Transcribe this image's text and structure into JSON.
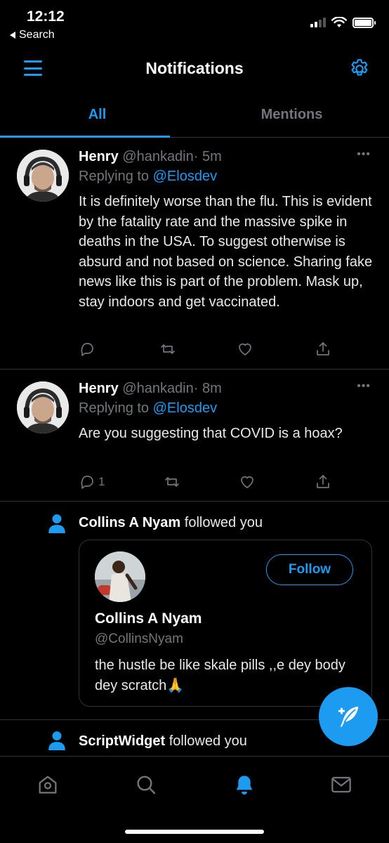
{
  "status_bar": {
    "time": "12:12",
    "back_label": "Search"
  },
  "header": {
    "title": "Notifications"
  },
  "tabs": [
    {
      "label": "All",
      "active": true
    },
    {
      "label": "Mentions",
      "active": false
    }
  ],
  "tweets": [
    {
      "name": "Henry",
      "handle": "@hankadin",
      "time": "· 5m",
      "replying_prefix": "Replying to",
      "replying_to": "@Elosdev",
      "text": "It is definitely worse than the flu. This is evident by the fatality rate and the massive spike in deaths in the USA. To suggest otherwise is absurd and not based on science. Sharing fake news like this is part of the problem. Mask up, stay indoors and get vaccinated.",
      "reply_count": ""
    },
    {
      "name": "Henry",
      "handle": "@hankadin",
      "time": "· 8m",
      "replying_prefix": "Replying to",
      "replying_to": "@Elosdev",
      "text": "Are you suggesting that COVID is a hoax?",
      "reply_count": "1"
    }
  ],
  "follows": [
    {
      "name": "Collins A Nyam",
      "action": "followed you",
      "card": {
        "name": "Collins A Nyam",
        "handle": "@CollinsNyam",
        "bio": "the hustle be like skale pills ,,e dey body dey scratch🙏",
        "button": "Follow"
      }
    },
    {
      "name": "ScriptWidget",
      "action": "followed you"
    }
  ],
  "icons": {
    "accent": "#1d9bf0",
    "muted": "#71767b",
    "nav": [
      "home-icon",
      "search-icon",
      "notifications-bell-icon",
      "messages-icon"
    ]
  }
}
